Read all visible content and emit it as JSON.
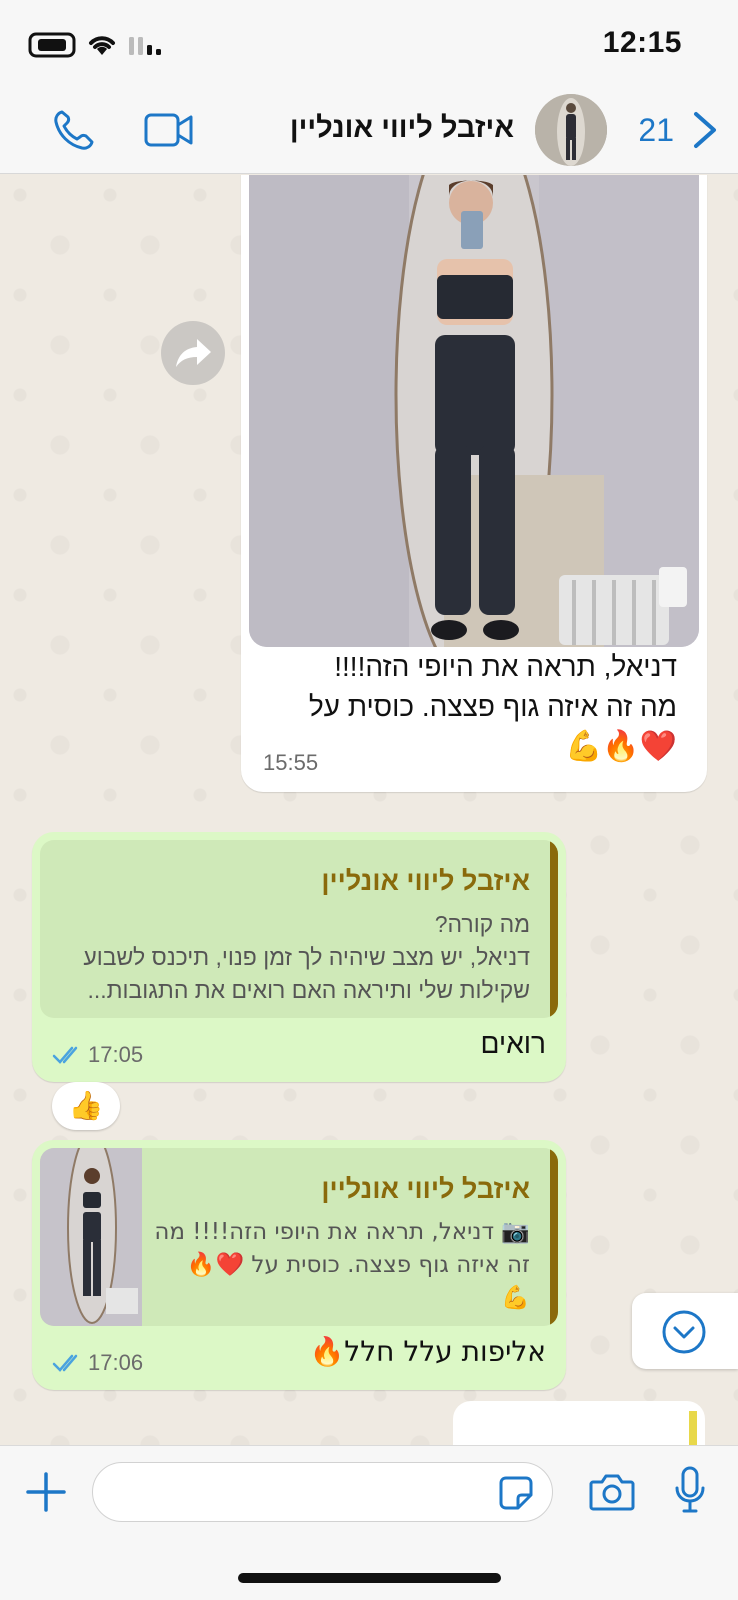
{
  "status_bar": {
    "time": "12:15"
  },
  "header": {
    "contact_name": "איזבל ליווי אונליין",
    "unread_count": "21"
  },
  "messages": [
    {
      "type": "incoming",
      "text_lines": [
        "דניאל, תראה את היופי הזה!!!!",
        "מה זה איזה גוף פצצה. כוסית על"
      ],
      "emoji_line": "❤️🔥💪",
      "time": "15:55"
    },
    {
      "type": "outgoing",
      "quote_author": "איזבל ליווי אונליין",
      "quote_lines": [
        "מה קורה?",
        "דניאל, יש מצב שיהיה לך זמן פנוי, תיכנס לשבוע",
        "שקילות שלי ותיראה האם רואים את התגובות..."
      ],
      "text": "רואים",
      "time": "17:05",
      "reaction": "👍"
    },
    {
      "type": "outgoing",
      "quote_author": "איזבל ליווי אונליין",
      "quote_lines": [
        "📷 דניאל, תראה את היופי הזה!!!! מה",
        "זה איזה גוף פצצה. כוסית על ❤️🔥",
        "💪"
      ],
      "text": "אליפות עלל חלל🔥",
      "time": "17:06"
    }
  ],
  "colors": {
    "accent": "#1d77c7",
    "outgoing_bubble": "#dcf8c6",
    "incoming_bubble": "#ffffff",
    "quote_author": "#8a6a0b",
    "chat_background": "#efeae2"
  },
  "icons": {
    "phone": "phone-icon",
    "video": "video-icon",
    "back": "chevron-right-icon",
    "forward": "forward-icon",
    "scroll_down": "chevron-down-circle-icon",
    "plus": "plus-icon",
    "sticker": "sticker-icon",
    "camera": "camera-icon",
    "mic": "mic-icon",
    "read_receipt": "double-check-icon"
  }
}
